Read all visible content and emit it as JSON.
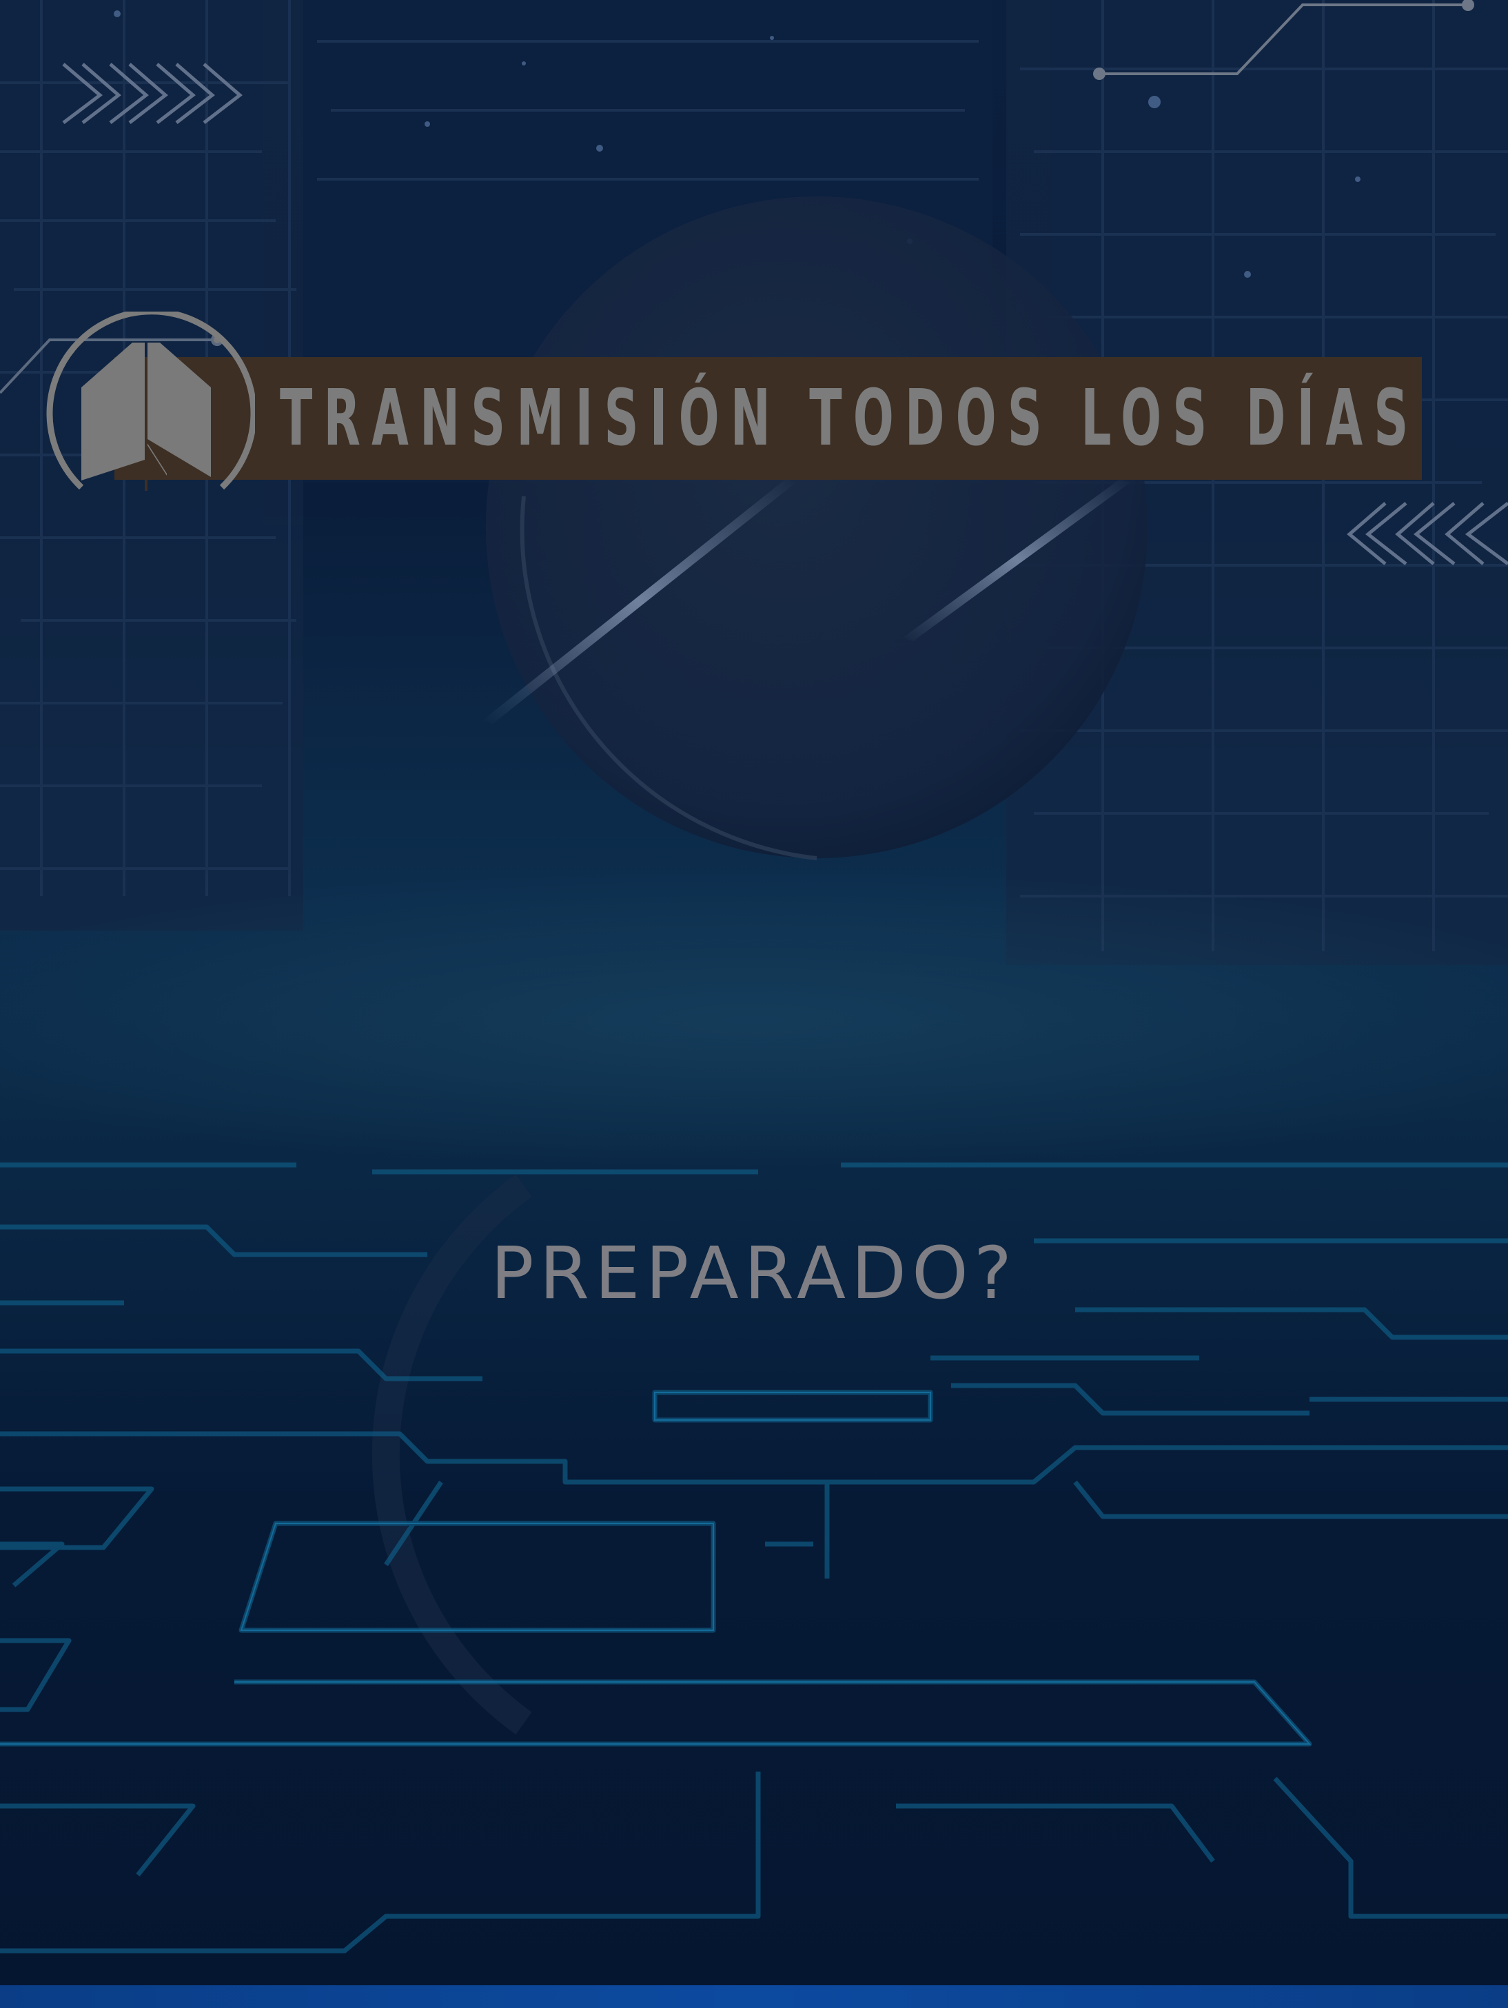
{
  "banner": {
    "text": "TRANSMISIÓN TODOS LOS DÍAS"
  },
  "tagline": "PREPARADO?",
  "colors": {
    "background": "#061a36",
    "banner": "#3d2f24",
    "text": "#7c7c7c",
    "accent_cyan": "#0e5f8a",
    "strip": "#0c4aa0"
  },
  "icons": [
    "chevrons-right-icon",
    "chevrons-left-icon",
    "circuit-line-icon",
    "logo-emblem-icon",
    "planet-icon"
  ]
}
